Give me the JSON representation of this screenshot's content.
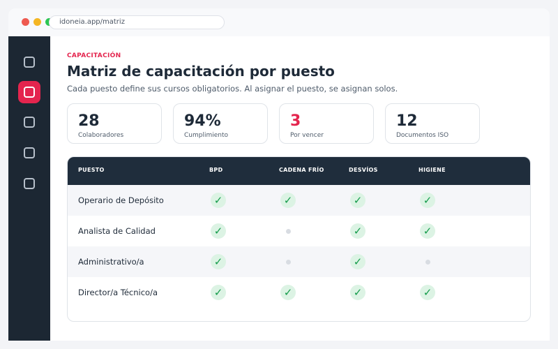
{
  "browser": {
    "url": "idoneia.app/matriz"
  },
  "sidebar": {
    "items": [
      {
        "icon": "square-icon",
        "active": false
      },
      {
        "icon": "square-icon",
        "active": true
      },
      {
        "icon": "square-icon",
        "active": false
      },
      {
        "icon": "square-icon",
        "active": false
      },
      {
        "icon": "square-icon",
        "active": false
      }
    ]
  },
  "header": {
    "eyebrow": "CAPACITACIÓN",
    "title": "Matriz de capacitación por puesto",
    "subtitle": "Cada puesto define sus cursos obligatorios. Al asignar el puesto, se asignan solos."
  },
  "stats": [
    {
      "value": "28",
      "label": "Colaboradores"
    },
    {
      "value": "94%",
      "label": "Cumplimiento"
    },
    {
      "value": "3",
      "label": "Por vencer"
    },
    {
      "value": "12",
      "label": "Documentos ISO"
    }
  ],
  "matrix": {
    "columns": [
      "PUESTO",
      "BPD",
      "CADENA FRÍO",
      "DESVÍOS",
      "HIGIENE"
    ],
    "rows": [
      {
        "role": "Operario de Depósito",
        "cells": [
          true,
          true,
          true,
          true
        ]
      },
      {
        "role": "Analista de Calidad",
        "cells": [
          true,
          false,
          true,
          true
        ]
      },
      {
        "role": "Administrativo/a",
        "cells": [
          true,
          false,
          true,
          false
        ]
      },
      {
        "role": "Director/a Técnico/a",
        "cells": [
          true,
          true,
          true,
          true
        ]
      }
    ],
    "check_glyph": "✓"
  },
  "colors": {
    "accent": "#e4254e",
    "sidebar": "#1c2733",
    "table_header": "#1f2d3c",
    "check": "#149c4a",
    "check_bg": "#dcf3e4"
  }
}
